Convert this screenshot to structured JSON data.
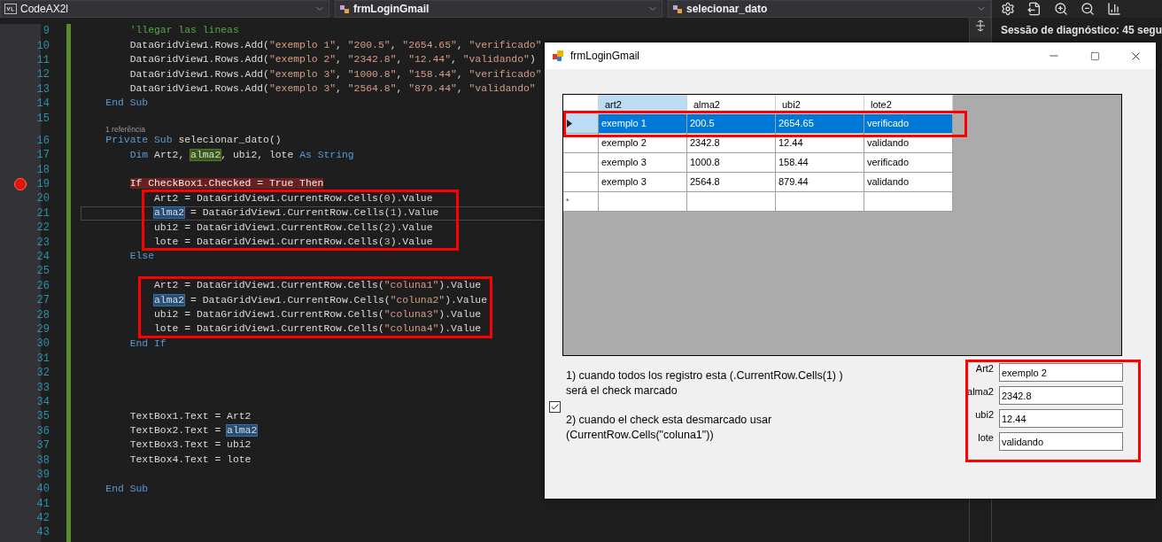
{
  "editor": {
    "dropdowns": [
      {
        "label": "CodeAX2l"
      },
      {
        "label": "frmLoginGmail"
      },
      {
        "label": "selecionar_dato"
      }
    ],
    "lines": [
      {
        "number": "9",
        "breakpoint": false,
        "current": false,
        "tokens": [
          {
            "kind": "cm",
            "text": "        'llegar las lineas"
          }
        ]
      },
      {
        "number": "10",
        "breakpoint": false,
        "current": false,
        "tokens": [
          {
            "kind": "tx",
            "text": "        DataGridView1.Rows.Add("
          },
          {
            "kind": "str",
            "text": "\"exemplo 1\""
          },
          {
            "kind": "tx",
            "text": ", "
          },
          {
            "kind": "str",
            "text": "\"200.5\""
          },
          {
            "kind": "tx",
            "text": ", "
          },
          {
            "kind": "str",
            "text": "\"2654.65\""
          },
          {
            "kind": "tx",
            "text": ", "
          },
          {
            "kind": "str",
            "text": "\"verificado\""
          }
        ]
      },
      {
        "number": "11",
        "breakpoint": false,
        "current": false,
        "tokens": [
          {
            "kind": "tx",
            "text": "        DataGridView1.Rows.Add("
          },
          {
            "kind": "str",
            "text": "\"exemplo 2\""
          },
          {
            "kind": "tx",
            "text": ", "
          },
          {
            "kind": "str",
            "text": "\"2342.8\""
          },
          {
            "kind": "tx",
            "text": ", "
          },
          {
            "kind": "str",
            "text": "\"12.44\""
          },
          {
            "kind": "tx",
            "text": ", "
          },
          {
            "kind": "str",
            "text": "\"validando\""
          },
          {
            "kind": "tx",
            "text": ")"
          }
        ]
      },
      {
        "number": "12",
        "breakpoint": false,
        "current": false,
        "tokens": [
          {
            "kind": "tx",
            "text": "        DataGridView1.Rows.Add("
          },
          {
            "kind": "str",
            "text": "\"exemplo 3\""
          },
          {
            "kind": "tx",
            "text": ", "
          },
          {
            "kind": "str",
            "text": "\"1000.8\""
          },
          {
            "kind": "tx",
            "text": ", "
          },
          {
            "kind": "str",
            "text": "\"158.44\""
          },
          {
            "kind": "tx",
            "text": ", "
          },
          {
            "kind": "str",
            "text": "\"verificado\""
          }
        ]
      },
      {
        "number": "13",
        "breakpoint": false,
        "current": false,
        "tokens": [
          {
            "kind": "tx",
            "text": "        DataGridView1.Rows.Add("
          },
          {
            "kind": "str",
            "text": "\"exemplo 3\""
          },
          {
            "kind": "tx",
            "text": ", "
          },
          {
            "kind": "str",
            "text": "\"2564.8\""
          },
          {
            "kind": "tx",
            "text": ", "
          },
          {
            "kind": "str",
            "text": "\"879.44\""
          },
          {
            "kind": "tx",
            "text": ", "
          },
          {
            "kind": "str",
            "text": "\"validando\""
          }
        ]
      },
      {
        "number": "14",
        "breakpoint": false,
        "current": false,
        "tokens": [
          {
            "kind": "kw",
            "text": "    End Sub"
          }
        ]
      },
      {
        "number": "15",
        "breakpoint": false,
        "current": false
      },
      {
        "number": "16",
        "breakpoint": false,
        "current": false,
        "codelens": "1 referência",
        "tokens": [
          {
            "kind": "kw",
            "text": "    Private Sub"
          },
          {
            "kind": "tx",
            "text": " selecionar_dato()"
          }
        ]
      },
      {
        "number": "17",
        "breakpoint": false,
        "current": false,
        "tokens": [
          {
            "kind": "kw",
            "text": "        Dim"
          },
          {
            "kind": "tx",
            "text": " Art2, "
          },
          {
            "kind": "hlg",
            "text": "alma2"
          },
          {
            "kind": "tx",
            "text": ", ubi2, lote "
          },
          {
            "kind": "kw",
            "text": "As String"
          }
        ]
      },
      {
        "number": "18",
        "breakpoint": false,
        "current": false
      },
      {
        "number": "19",
        "breakpoint": true,
        "current": false,
        "tokens": [
          {
            "kind": "err",
            "text": "        If CheckBox1.Checked = True Then"
          }
        ]
      },
      {
        "number": "20",
        "breakpoint": false,
        "current": false,
        "tokens": [
          {
            "kind": "tx",
            "text": "            Art2 = DataGridView1.CurrentRow.Cells("
          },
          {
            "kind": "num",
            "text": "0"
          },
          {
            "kind": "tx",
            "text": ").Value"
          }
        ]
      },
      {
        "number": "21",
        "breakpoint": false,
        "current": true,
        "tokens": [
          {
            "kind": "hlb",
            "text": "            alma2"
          },
          {
            "kind": "tx",
            "text": " = DataGridView1.CurrentRow.Cells("
          },
          {
            "kind": "num",
            "text": "1"
          },
          {
            "kind": "tx",
            "text": ").Value"
          }
        ]
      },
      {
        "number": "22",
        "breakpoint": false,
        "current": false,
        "tokens": [
          {
            "kind": "tx",
            "text": "            ubi2 = DataGridView1.CurrentRow.Cells("
          },
          {
            "kind": "num",
            "text": "2"
          },
          {
            "kind": "tx",
            "text": ").Value"
          }
        ]
      },
      {
        "number": "23",
        "breakpoint": false,
        "current": false,
        "tokens": [
          {
            "kind": "tx",
            "text": "            lote = DataGridView1.CurrentRow.Cells("
          },
          {
            "kind": "num",
            "text": "3"
          },
          {
            "kind": "tx",
            "text": ").Value"
          }
        ]
      },
      {
        "number": "24",
        "breakpoint": false,
        "current": false,
        "tokens": [
          {
            "kind": "kw",
            "text": "        Else"
          }
        ]
      },
      {
        "number": "25",
        "breakpoint": false,
        "current": false
      },
      {
        "number": "26",
        "breakpoint": false,
        "current": false,
        "tokens": [
          {
            "kind": "tx",
            "text": "            Art2 = DataGridView1.CurrentRow.Cells("
          },
          {
            "kind": "str",
            "text": "\"coluna1\""
          },
          {
            "kind": "tx",
            "text": ").Value"
          }
        ]
      },
      {
        "number": "27",
        "breakpoint": false,
        "current": false,
        "tokens": [
          {
            "kind": "hlb",
            "text": "            alma2"
          },
          {
            "kind": "tx",
            "text": " = DataGridView1.CurrentRow.Cells("
          },
          {
            "kind": "str",
            "text": "\"coluna2\""
          },
          {
            "kind": "tx",
            "text": ").Value"
          }
        ]
      },
      {
        "number": "28",
        "breakpoint": false,
        "current": false,
        "tokens": [
          {
            "kind": "tx",
            "text": "            ubi2 = DataGridView1.CurrentRow.Cells("
          },
          {
            "kind": "str",
            "text": "\"coluna3\""
          },
          {
            "kind": "tx",
            "text": ").Value"
          }
        ]
      },
      {
        "number": "29",
        "breakpoint": false,
        "current": false,
        "tokens": [
          {
            "kind": "tx",
            "text": "            lote = DataGridView1.CurrentRow.Cells("
          },
          {
            "kind": "str",
            "text": "\"coluna4\""
          },
          {
            "kind": "tx",
            "text": ").Value"
          }
        ]
      },
      {
        "number": "30",
        "breakpoint": false,
        "current": false,
        "tokens": [
          {
            "kind": "kw",
            "text": "        End If"
          }
        ]
      },
      {
        "number": "31",
        "breakpoint": false,
        "current": false
      },
      {
        "number": "32",
        "breakpoint": false,
        "current": false
      },
      {
        "number": "33",
        "breakpoint": false,
        "current": false
      },
      {
        "number": "34",
        "breakpoint": false,
        "current": false
      },
      {
        "number": "35",
        "breakpoint": false,
        "current": false,
        "tokens": [
          {
            "kind": "tx",
            "text": "        TextBox1.Text = Art2"
          }
        ]
      },
      {
        "number": "36",
        "breakpoint": false,
        "current": false,
        "tokens": [
          {
            "kind": "tx",
            "text": "        TextBox2.Text = "
          },
          {
            "kind": "hlb",
            "text": "alma2"
          }
        ]
      },
      {
        "number": "37",
        "breakpoint": false,
        "current": false,
        "tokens": [
          {
            "kind": "tx",
            "text": "        TextBox3.Text = ubi2"
          }
        ]
      },
      {
        "number": "38",
        "breakpoint": false,
        "current": false,
        "tokens": [
          {
            "kind": "tx",
            "text": "        TextBox4.Text = lote"
          }
        ]
      },
      {
        "number": "39",
        "breakpoint": false,
        "current": false
      },
      {
        "number": "40",
        "breakpoint": false,
        "current": false,
        "tokens": [
          {
            "kind": "kw",
            "text": "    End Sub"
          }
        ]
      },
      {
        "number": "41",
        "breakpoint": false,
        "current": false
      },
      {
        "number": "42",
        "breakpoint": false,
        "current": false
      },
      {
        "number": "43",
        "breakpoint": false,
        "current": false
      }
    ]
  },
  "diagnostics": {
    "title": "Sessão de diagnóstico: 45 segu"
  },
  "form": {
    "title": "frmLoginGmail",
    "grid": {
      "columns": [
        {
          "label": "art2",
          "selected": true
        },
        {
          "label": "alma2",
          "selected": false
        },
        {
          "label": "ubi2",
          "selected": false
        },
        {
          "label": "lote2",
          "selected": false
        }
      ],
      "rows": [
        {
          "selected": true,
          "cells": [
            "exemplo 1",
            "200.5",
            "2654.65",
            "verificado"
          ]
        },
        {
          "selected": false,
          "cells": [
            "exemplo 2",
            "2342.8",
            "12.44",
            "validando"
          ]
        },
        {
          "selected": false,
          "cells": [
            "exemplo 3",
            "1000.8",
            "158.44",
            "verificado"
          ]
        },
        {
          "selected": false,
          "cells": [
            "exemplo 3",
            "2564.8",
            "879.44",
            "validando"
          ]
        }
      ],
      "new_row_marker": "*"
    },
    "checkbox": {
      "checked": true
    },
    "notes": [
      {
        "lines": [
          "1) cuando todos los registro esta (.CurrentRow.Cells(1) )",
          "será el check marcado"
        ]
      },
      {
        "lines": [
          "2) cuando el check esta desmarcado usar",
          "(CurrentRow.Cells(\"coluna1\"))"
        ]
      }
    ],
    "fields": [
      {
        "label": "Art2",
        "value": "exemplo 2"
      },
      {
        "label": "alma2",
        "value": "2342.8"
      },
      {
        "label": "ubi2",
        "value": "12.44"
      },
      {
        "label": "lote",
        "value": "validando"
      }
    ]
  }
}
